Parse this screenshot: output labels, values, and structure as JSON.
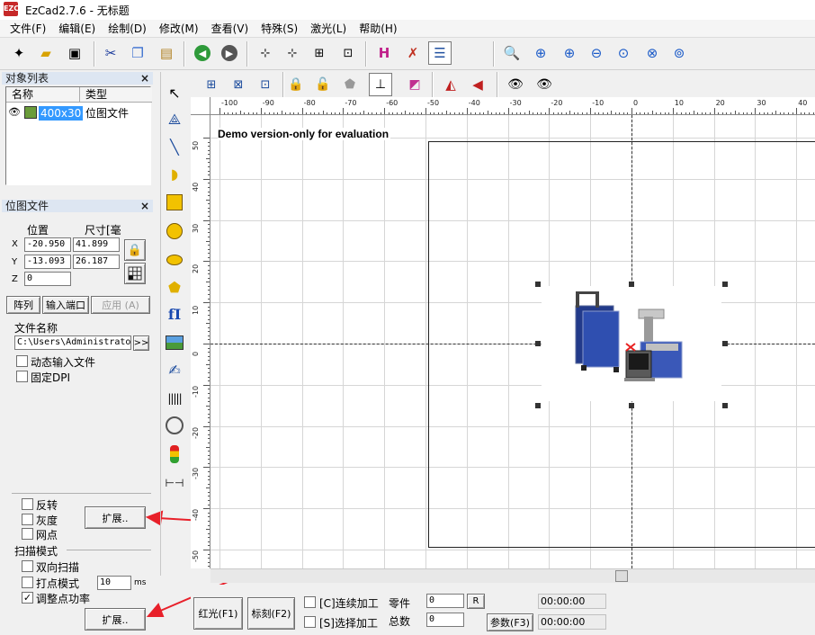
{
  "window": {
    "title": "EzCad2.7.6 - 无标题",
    "app_icon_text": "EZCAD"
  },
  "menu": [
    "文件(F)",
    "编辑(E)",
    "绘制(D)",
    "修改(M)",
    "查看(V)",
    "特殊(S)",
    "激光(L)",
    "帮助(H)"
  ],
  "object_list": {
    "title": "对象列表",
    "col_name": "名称",
    "col_type": "类型",
    "row_name": "400x30",
    "row_type": "位图文件"
  },
  "bitmap_panel": {
    "title": "位图文件",
    "pos_label": "位置",
    "size_label": "尺寸[毫",
    "x_label": "X",
    "y_label": "Y",
    "z_label": "Z",
    "x_pos": "-20.950",
    "x_size": "41.899",
    "y_pos": "-13.093",
    "y_size": "26.187",
    "z_pos": "0",
    "array_btn": "阵列",
    "port_btn": "输入端口",
    "apply_btn": "应用 (A)",
    "filename_label": "文件名称",
    "filename": "C:\\Users\\Administrato",
    "browse_btn": ">>",
    "dynamic_label": "动态输入文件",
    "fixed_dpi_label": "固定DPI",
    "invert_label": "反转",
    "gray_label": "灰度",
    "dither_label": "网点",
    "expand_btn_1": "扩展..",
    "scan_mode_label": "扫描模式",
    "bidir_label": "双向扫描",
    "dot_mode_label": "打点模式",
    "dot_value": "10",
    "dot_unit": "ms",
    "adjust_power_label": "调整点功率",
    "adjust_power_checked": true,
    "expand_btn_2": "扩展.."
  },
  "canvas": {
    "demo_text": "Demo version-only for evaluation",
    "ruler_top": [
      "-100",
      "-90",
      "-80",
      "-70",
      "-60",
      "-50",
      "-40",
      "-30",
      "-20",
      "-10",
      "0",
      "10",
      "20",
      "30",
      "40"
    ],
    "ruler_left": [
      "50",
      "40",
      "30",
      "20",
      "10",
      "0",
      "-10",
      "-20",
      "-30",
      "-40",
      "-50"
    ]
  },
  "bottom": {
    "red_light_btn": "红光(F1)",
    "mark_btn": "标刻(F2)",
    "continuous_label": "[C]连续加工",
    "selected_label": "[S]选择加工",
    "parts_label": "零件",
    "total_label": "总数",
    "parts_value": "0",
    "total_value": "0",
    "reset_btn": "R",
    "param_btn": "参数(F3)",
    "time1": "00:00:00",
    "time2": "00:00:00"
  },
  "colors": {
    "accent_red": "#e8202a",
    "selection_blue": "#3399ff",
    "panel_title_bg": "#dde6f2"
  }
}
